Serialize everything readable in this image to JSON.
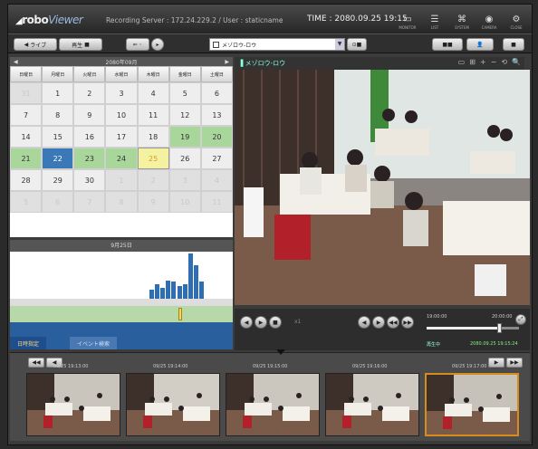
{
  "app": {
    "logo_main": "robo",
    "logo_sub": "Viewer",
    "recording_info": "Recording Server : 172.24.229.2 / User : staticname",
    "time_label": "TIME :",
    "time_value": "2080.09.25 19:15",
    "toolbar_icons": [
      {
        "icon": "monitor-icon",
        "glyph": "▭",
        "label": "MONITOR"
      },
      {
        "icon": "list-icon",
        "glyph": "☰",
        "label": "LIST"
      },
      {
        "icon": "config-icon",
        "glyph": "⌘",
        "label": "SYSTEM"
      },
      {
        "icon": "camera-icon",
        "glyph": "◉",
        "label": "CAMERA"
      },
      {
        "icon": "settings-icon",
        "glyph": "⚙",
        "label": "CLOSE"
      }
    ]
  },
  "toolbar": {
    "live_label": "ライブ",
    "playback_label": "再生",
    "camera_select": "メゾロウ-ロウ",
    "right_button_1": "■■",
    "right_button_2": "■"
  },
  "calendar": {
    "month_label": "2080年09月",
    "weekdays": [
      "日曜日",
      "月曜日",
      "火曜日",
      "水曜日",
      "木曜日",
      "金曜日",
      "土曜日"
    ],
    "days": [
      {
        "d": "31",
        "s": "dim"
      },
      {
        "d": "1",
        "s": ""
      },
      {
        "d": "2",
        "s": ""
      },
      {
        "d": "3",
        "s": ""
      },
      {
        "d": "4",
        "s": ""
      },
      {
        "d": "5",
        "s": ""
      },
      {
        "d": "6",
        "s": ""
      },
      {
        "d": "7",
        "s": ""
      },
      {
        "d": "8",
        "s": ""
      },
      {
        "d": "9",
        "s": ""
      },
      {
        "d": "10",
        "s": ""
      },
      {
        "d": "11",
        "s": ""
      },
      {
        "d": "12",
        "s": ""
      },
      {
        "d": "13",
        "s": ""
      },
      {
        "d": "14",
        "s": ""
      },
      {
        "d": "15",
        "s": ""
      },
      {
        "d": "16",
        "s": ""
      },
      {
        "d": "17",
        "s": ""
      },
      {
        "d": "18",
        "s": ""
      },
      {
        "d": "19",
        "s": "green"
      },
      {
        "d": "20",
        "s": "green"
      },
      {
        "d": "21",
        "s": "green"
      },
      {
        "d": "22",
        "s": "blue"
      },
      {
        "d": "23",
        "s": "green"
      },
      {
        "d": "24",
        "s": "green"
      },
      {
        "d": "25",
        "s": "yellow"
      },
      {
        "d": "26",
        "s": ""
      },
      {
        "d": "27",
        "s": ""
      },
      {
        "d": "28",
        "s": ""
      },
      {
        "d": "29",
        "s": ""
      },
      {
        "d": "30",
        "s": ""
      },
      {
        "d": "1",
        "s": "dim"
      },
      {
        "d": "2",
        "s": "dim"
      },
      {
        "d": "3",
        "s": "dim"
      },
      {
        "d": "4",
        "s": "dim"
      },
      {
        "d": "5",
        "s": "dim"
      },
      {
        "d": "6",
        "s": "dim"
      },
      {
        "d": "7",
        "s": "dim"
      },
      {
        "d": "8",
        "s": "dim"
      },
      {
        "d": "9",
        "s": "dim"
      },
      {
        "d": "10",
        "s": "dim"
      },
      {
        "d": "11",
        "s": "dim"
      }
    ]
  },
  "histogram": {
    "title": "9月25日",
    "values": [
      0,
      0,
      0,
      0,
      0,
      0,
      0,
      0,
      0,
      0,
      0,
      0,
      0,
      0,
      0,
      0,
      0,
      0,
      0,
      0,
      0,
      0,
      0,
      0,
      0,
      10,
      16,
      12,
      20,
      19,
      14,
      16,
      50,
      37,
      19,
      0,
      0,
      0,
      0,
      0
    ],
    "cursor_fraction": 0.77
  },
  "tabs": {
    "tab1": "日時指定",
    "tab2": "イベント検索"
  },
  "video": {
    "title": "メゾロウ-ロウ",
    "controls": [
      "▭",
      "⊞",
      "+",
      "−",
      "⟲",
      "🔍"
    ]
  },
  "playback": {
    "speed_label": "x1",
    "start_time": "19:00:00",
    "end_time": "20:00:00",
    "progress": 0.78,
    "status": "再生中",
    "current": "2080.09.25 19:15:24"
  },
  "thumbnails": {
    "prev_label": "◀◀",
    "prev2_label": "◀",
    "next_label": "▶",
    "next2_label": "▶▶",
    "items": [
      {
        "ts": "09/25 19:13:00",
        "sel": false
      },
      {
        "ts": "09/25 19:14:00",
        "sel": false
      },
      {
        "ts": "09/25 19:15:00",
        "sel": false
      },
      {
        "ts": "09/25 19:16:00",
        "sel": false
      },
      {
        "ts": "09/25 19:17:00",
        "sel": true
      }
    ]
  },
  "colors": {
    "accent": "#2f6eb0",
    "selected": "#d98c1e",
    "highlight": "#a9d69b"
  }
}
